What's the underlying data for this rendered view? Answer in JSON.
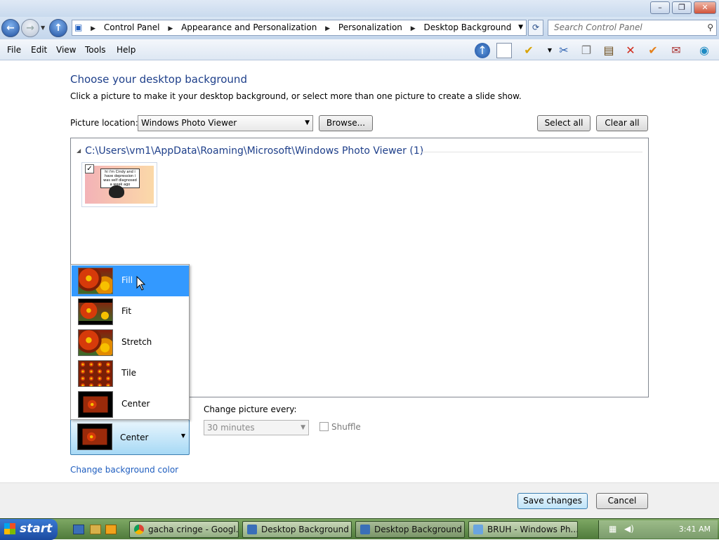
{
  "window": {
    "controls": {
      "minimize": "–",
      "maximize": "❐",
      "close": "✕"
    }
  },
  "address": {
    "crumbs": [
      "Control Panel",
      "Appearance and Personalization",
      "Personalization",
      "Desktop Background"
    ],
    "search_placeholder": "Search Control Panel"
  },
  "menubar": {
    "items": [
      "File",
      "Edit",
      "View",
      "Tools",
      "Help"
    ]
  },
  "content": {
    "title": "Choose your desktop background",
    "subtitle": "Click a picture to make it your desktop background, or select more than one picture to create a slide show.",
    "location_label": "Picture location:",
    "location_value": "Windows Photo Viewer",
    "browse_label": "Browse...",
    "select_all_label": "Select all",
    "clear_all_label": "Clear all",
    "group_header": "C:\\Users\\vm1\\AppData\\Roaming\\Microsoft\\Windows Photo Viewer (1)",
    "thumbnail_text": "hi i'm Cindy and i have depression i was self diagnosed a week ago",
    "thumbnail_checked": true,
    "position_options": [
      "Fill",
      "Fit",
      "Stretch",
      "Tile",
      "Center"
    ],
    "position_highlighted": "Fill",
    "position_selected": "Center",
    "change_every_label": "Change picture every:",
    "interval_value": "30 minutes",
    "shuffle_label": "Shuffle",
    "change_color_link": "Change background color",
    "save_label": "Save changes",
    "cancel_label": "Cancel"
  },
  "taskbar": {
    "start_label": "start",
    "tasks": [
      "gacha cringe - Googl...",
      "Desktop Background",
      "Desktop Background",
      "BRUH - Windows Ph..."
    ],
    "clock": "3:41 AM"
  }
}
